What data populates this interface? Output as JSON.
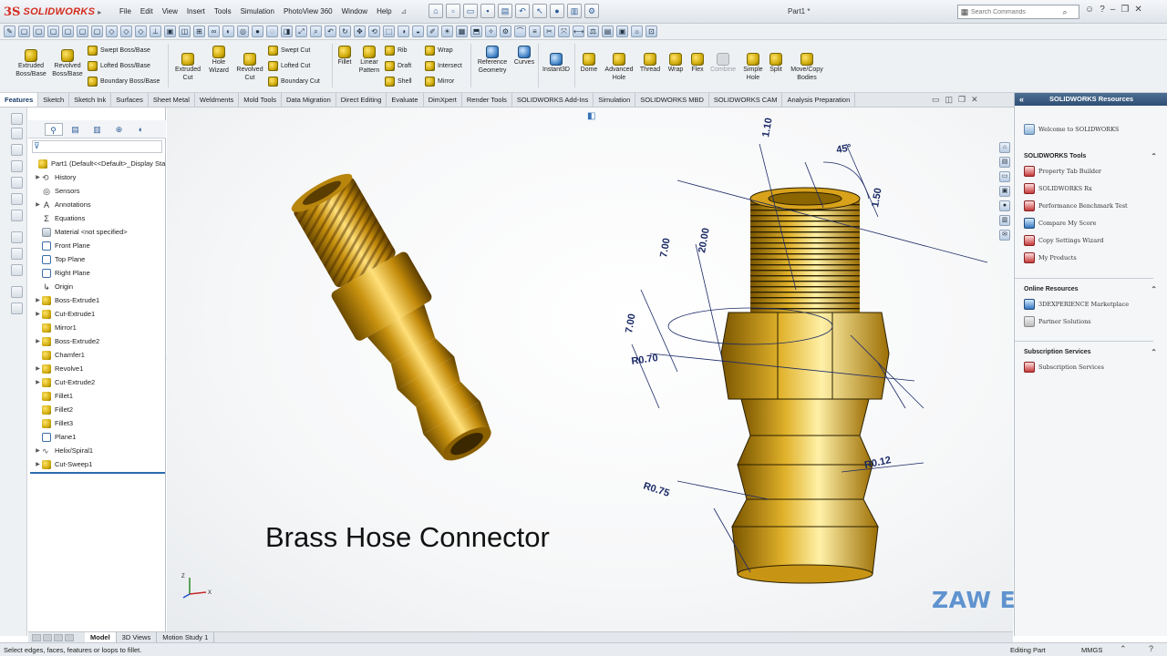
{
  "app": {
    "name": "SOLIDWORKS",
    "logo_mark": "3S",
    "document_title": "Part1 *"
  },
  "menu": [
    "File",
    "Edit",
    "View",
    "Insert",
    "Tools",
    "Simulation",
    "PhotoView 360",
    "Window",
    "Help"
  ],
  "search": {
    "placeholder": "Search Commands"
  },
  "ribbon": {
    "extruded_boss": "Extruded Boss/Base",
    "revolved_boss": "Revolved Boss/Base",
    "swept_boss": "Swept Boss/Base",
    "lofted_boss": "Lofted Boss/Base",
    "boundary_boss": "Boundary Boss/Base",
    "extruded_cut": "Extruded Cut",
    "hole_wizard": "Hole Wizard",
    "revolved_cut": "Revolved Cut",
    "swept_cut": "Swept Cut",
    "lofted_cut": "Lofted Cut",
    "boundary_cut": "Boundary Cut",
    "fillet": "Fillet",
    "linear_pattern": "Linear Pattern",
    "rib": "Rib",
    "draft": "Draft",
    "shell": "Shell",
    "wrap": "Wrap",
    "intersect": "Intersect",
    "mirror": "Mirror",
    "reference_geometry": "Reference Geometry",
    "curves": "Curves",
    "instant3d": "Instant3D",
    "dome": "Dome",
    "advanced_hole": "Advanced Hole",
    "thread": "Thread",
    "wrap2": "Wrap",
    "flex": "Flex",
    "combine": "Combine",
    "simple_hole": "Simple Hole",
    "split": "Split",
    "move_copy": "Move/Copy Bodies"
  },
  "tabs": [
    "Features",
    "Sketch",
    "Sketch Ink",
    "Surfaces",
    "Sheet Metal",
    "Weldments",
    "Mold Tools",
    "Data Migration",
    "Direct Editing",
    "Evaluate",
    "DimXpert",
    "Render Tools",
    "SOLIDWORKS Add-Ins",
    "Simulation",
    "SOLIDWORKS MBD",
    "SOLIDWORKS CAM",
    "Analysis Preparation"
  ],
  "active_tab": "Features",
  "tree": [
    {
      "label": "Part1  (Default<<Default>_Display Sta",
      "icon": "part",
      "arrow": ""
    },
    {
      "label": "History",
      "icon": "history",
      "arrow": "▶"
    },
    {
      "label": "Sensors",
      "icon": "sensor",
      "arrow": ""
    },
    {
      "label": "Annotations",
      "icon": "annotation",
      "arrow": "▶"
    },
    {
      "label": "Equations",
      "icon": "equation",
      "arrow": ""
    },
    {
      "label": "Material <not specified>",
      "icon": "material",
      "arrow": ""
    },
    {
      "label": "Front Plane",
      "icon": "plane",
      "arrow": ""
    },
    {
      "label": "Top Plane",
      "icon": "plane",
      "arrow": ""
    },
    {
      "label": "Right Plane",
      "icon": "plane",
      "arrow": ""
    },
    {
      "label": "Origin",
      "icon": "origin",
      "arrow": ""
    },
    {
      "label": "Boss-Extrude1",
      "icon": "feature",
      "arrow": "▶"
    },
    {
      "label": "Cut-Extrude1",
      "icon": "feature",
      "arrow": "▶"
    },
    {
      "label": "Mirror1",
      "icon": "feature",
      "arrow": ""
    },
    {
      "label": "Boss-Extrude2",
      "icon": "feature",
      "arrow": "▶"
    },
    {
      "label": "Chamfer1",
      "icon": "feature",
      "arrow": ""
    },
    {
      "label": "Revolve1",
      "icon": "feature",
      "arrow": "▶"
    },
    {
      "label": "Cut-Extrude2",
      "icon": "feature",
      "arrow": "▶"
    },
    {
      "label": "Fillet1",
      "icon": "feature",
      "arrow": ""
    },
    {
      "label": "Fillet2",
      "icon": "feature",
      "arrow": ""
    },
    {
      "label": "Fillet3",
      "icon": "feature",
      "arrow": ""
    },
    {
      "label": "Plane1",
      "icon": "plane",
      "arrow": ""
    },
    {
      "label": "Helix/Spiral1",
      "icon": "helix",
      "arrow": "▶"
    },
    {
      "label": "Cut-Sweep1",
      "icon": "feature",
      "arrow": "▶"
    }
  ],
  "graphics": {
    "caption": "Brass Hose Connector",
    "watermark": "ZAW Engineering",
    "dimensions": {
      "d1": "1.10",
      "d2": "45°",
      "d3": "1.50",
      "d4": "20.00",
      "d5": "7.00",
      "d6": "7.00",
      "d7": "R0.70",
      "d8": "R0.12",
      "d9": "R0.75"
    },
    "brass_color": "#d4a017"
  },
  "task_pane": {
    "title": "SOLIDWORKS Resources",
    "welcome": "Welcome to SOLIDWORKS",
    "tools_header": "SOLIDWORKS Tools",
    "tools": [
      "Property Tab Builder",
      "SOLIDWORKS Rx",
      "Performance Benchmark Test",
      "Compare My Score",
      "Copy Settings Wizard",
      "My Products"
    ],
    "online_header": "Online Resources",
    "online": [
      "3DEXPERIENCE Marketplace",
      "Partner Solutions"
    ],
    "subscription_header": "Subscription Services",
    "subscription": [
      "Subscription Services"
    ]
  },
  "bottom_tabs": [
    "Model",
    "3D Views",
    "Motion Study 1"
  ],
  "status": {
    "message": "Select edges, faces, features or loops to fillet.",
    "mode": "Editing Part",
    "units": "MMGS"
  },
  "colors": {
    "accent": "#2f4f74",
    "brand": "#d52b1e",
    "watermark": "#5f93cf"
  }
}
